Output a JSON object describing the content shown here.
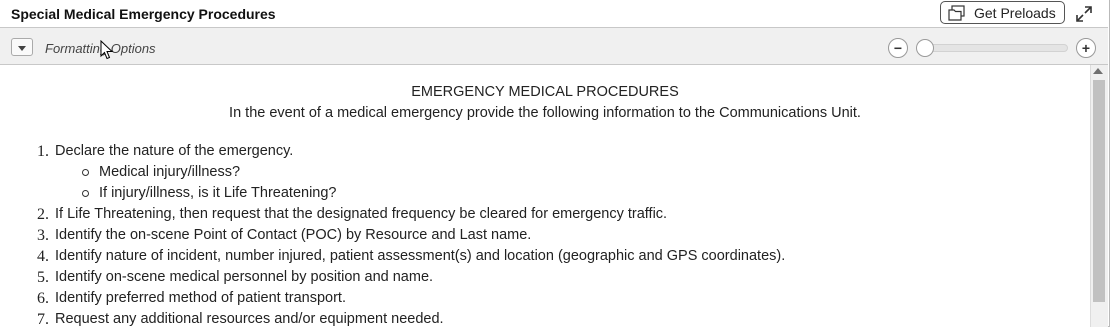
{
  "header": {
    "title": "Special Medical Emergency Procedures",
    "preload_button_label": "Get Preloads",
    "preload_icon": "folder-stack-icon",
    "expand_icon": "expand-arrows-icon"
  },
  "toolbar": {
    "dropdown_icon": "chevron-down-icon",
    "formatting_label": "Formatting Options",
    "zoom_out_label": "−",
    "zoom_in_label": "+",
    "zoom_level": 0
  },
  "document": {
    "title": "EMERGENCY MEDICAL PROCEDURES",
    "subtitle": "In the event of a medical emergency provide the following information to the Communications Unit.",
    "steps": [
      {
        "num": "1.",
        "text": "Declare the nature of the emergency.",
        "bullets": [
          "Medical injury/illness?",
          "If injury/illness, is it Life Threatening?"
        ]
      },
      {
        "num": "2.",
        "text": "If Life Threatening, then request that the designated frequency be cleared for emergency traffic."
      },
      {
        "num": "3.",
        "text": "Identify the on-scene Point of Contact (POC) by Resource and Last name."
      },
      {
        "num": "4.",
        "text": "Identify nature of incident, number injured, patient assessment(s) and location (geographic and GPS coordinates)."
      },
      {
        "num": "5.",
        "text": "Identify on-scene medical personnel by position and name."
      },
      {
        "num": "6.",
        "text": "Identify preferred method of patient transport."
      },
      {
        "num": "7.",
        "text": "Request any additional resources and/or equipment needed."
      }
    ]
  },
  "colors": {
    "toolbar_bg": "#f0f0f0",
    "scroll_thumb": "#c1c1c1",
    "text": "#222222"
  }
}
